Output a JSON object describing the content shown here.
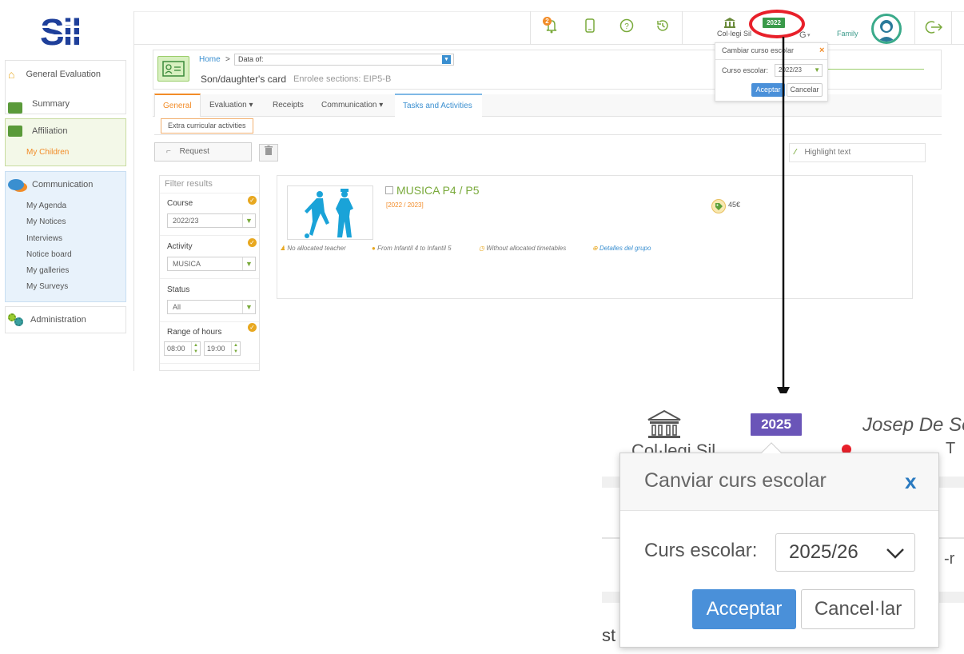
{
  "app": {
    "logo": "Sil"
  },
  "sidebar": {
    "general_evaluation": "General Evaluation",
    "summary": "Summary",
    "affiliation": "Affiliation",
    "my_children": "My Children",
    "communication": "Communication",
    "comm_items": [
      "My Agenda",
      "My Notices",
      "Interviews",
      "Notice board",
      "My galleries",
      "My Surveys"
    ],
    "administration": "Administration"
  },
  "topbar": {
    "notification_count": "2",
    "school_name": "Col·legi Sil",
    "year_badge": "2022",
    "user_initial": "G",
    "family_label": "Family"
  },
  "popup_small": {
    "title": "Cambiar curso escolar",
    "close": "×",
    "label": "Curso escolar:",
    "value": "2022/23",
    "accept": "Aceptar",
    "cancel": "Cancelar"
  },
  "card": {
    "breadcrumb_home": "Home",
    "breadcrumb_sep": ">",
    "data_of": "Data of:",
    "title": "Son/daughter's card",
    "subtitle": "Enrolee sections: EIP5-B"
  },
  "tabs": [
    "General",
    "Evaluation",
    "Receipts",
    "Communication",
    "Tasks and Activities"
  ],
  "subtab": "Extra curricular activities",
  "toolbar": {
    "request": "Request",
    "highlight": "Highlight text"
  },
  "filters": {
    "title": "Filter results",
    "course_label": "Course",
    "course_value": "2022/23",
    "activity_label": "Activity",
    "activity_value": "MUSICA",
    "status_label": "Status",
    "status_value": "All",
    "hours_label": "Range of hours",
    "hour_from": "08:00",
    "hour_to": "19:00"
  },
  "activity": {
    "title": "MUSICA P4 / P5",
    "years": "[2022 / 2023]",
    "price": "45€",
    "teacher": "No allocated teacher",
    "levels": "From Infantil 4 to Infantil 5",
    "timetable": "Without allocated timetables",
    "details": "Detalles del grupo"
  },
  "zoom": {
    "school_partial": "Col·legi Sil",
    "year_badge": "2025",
    "user_partial": "Josep De So",
    "title": "Canviar curs escolar",
    "close": "x",
    "label": "Curs escolar:",
    "value": "2025/26",
    "accept": "Acceptar",
    "cancel": "Cancel·lar",
    "edge_text_1": "-r",
    "edge_text_2": "st"
  },
  "colors": {
    "green": "#7aaa3c",
    "orange": "#f28c28",
    "blue": "#3a8fd0",
    "zoom_badge": "#6a55b8",
    "highlight_ring": "#e8202a",
    "sil_blue": "#1e3f9a"
  }
}
